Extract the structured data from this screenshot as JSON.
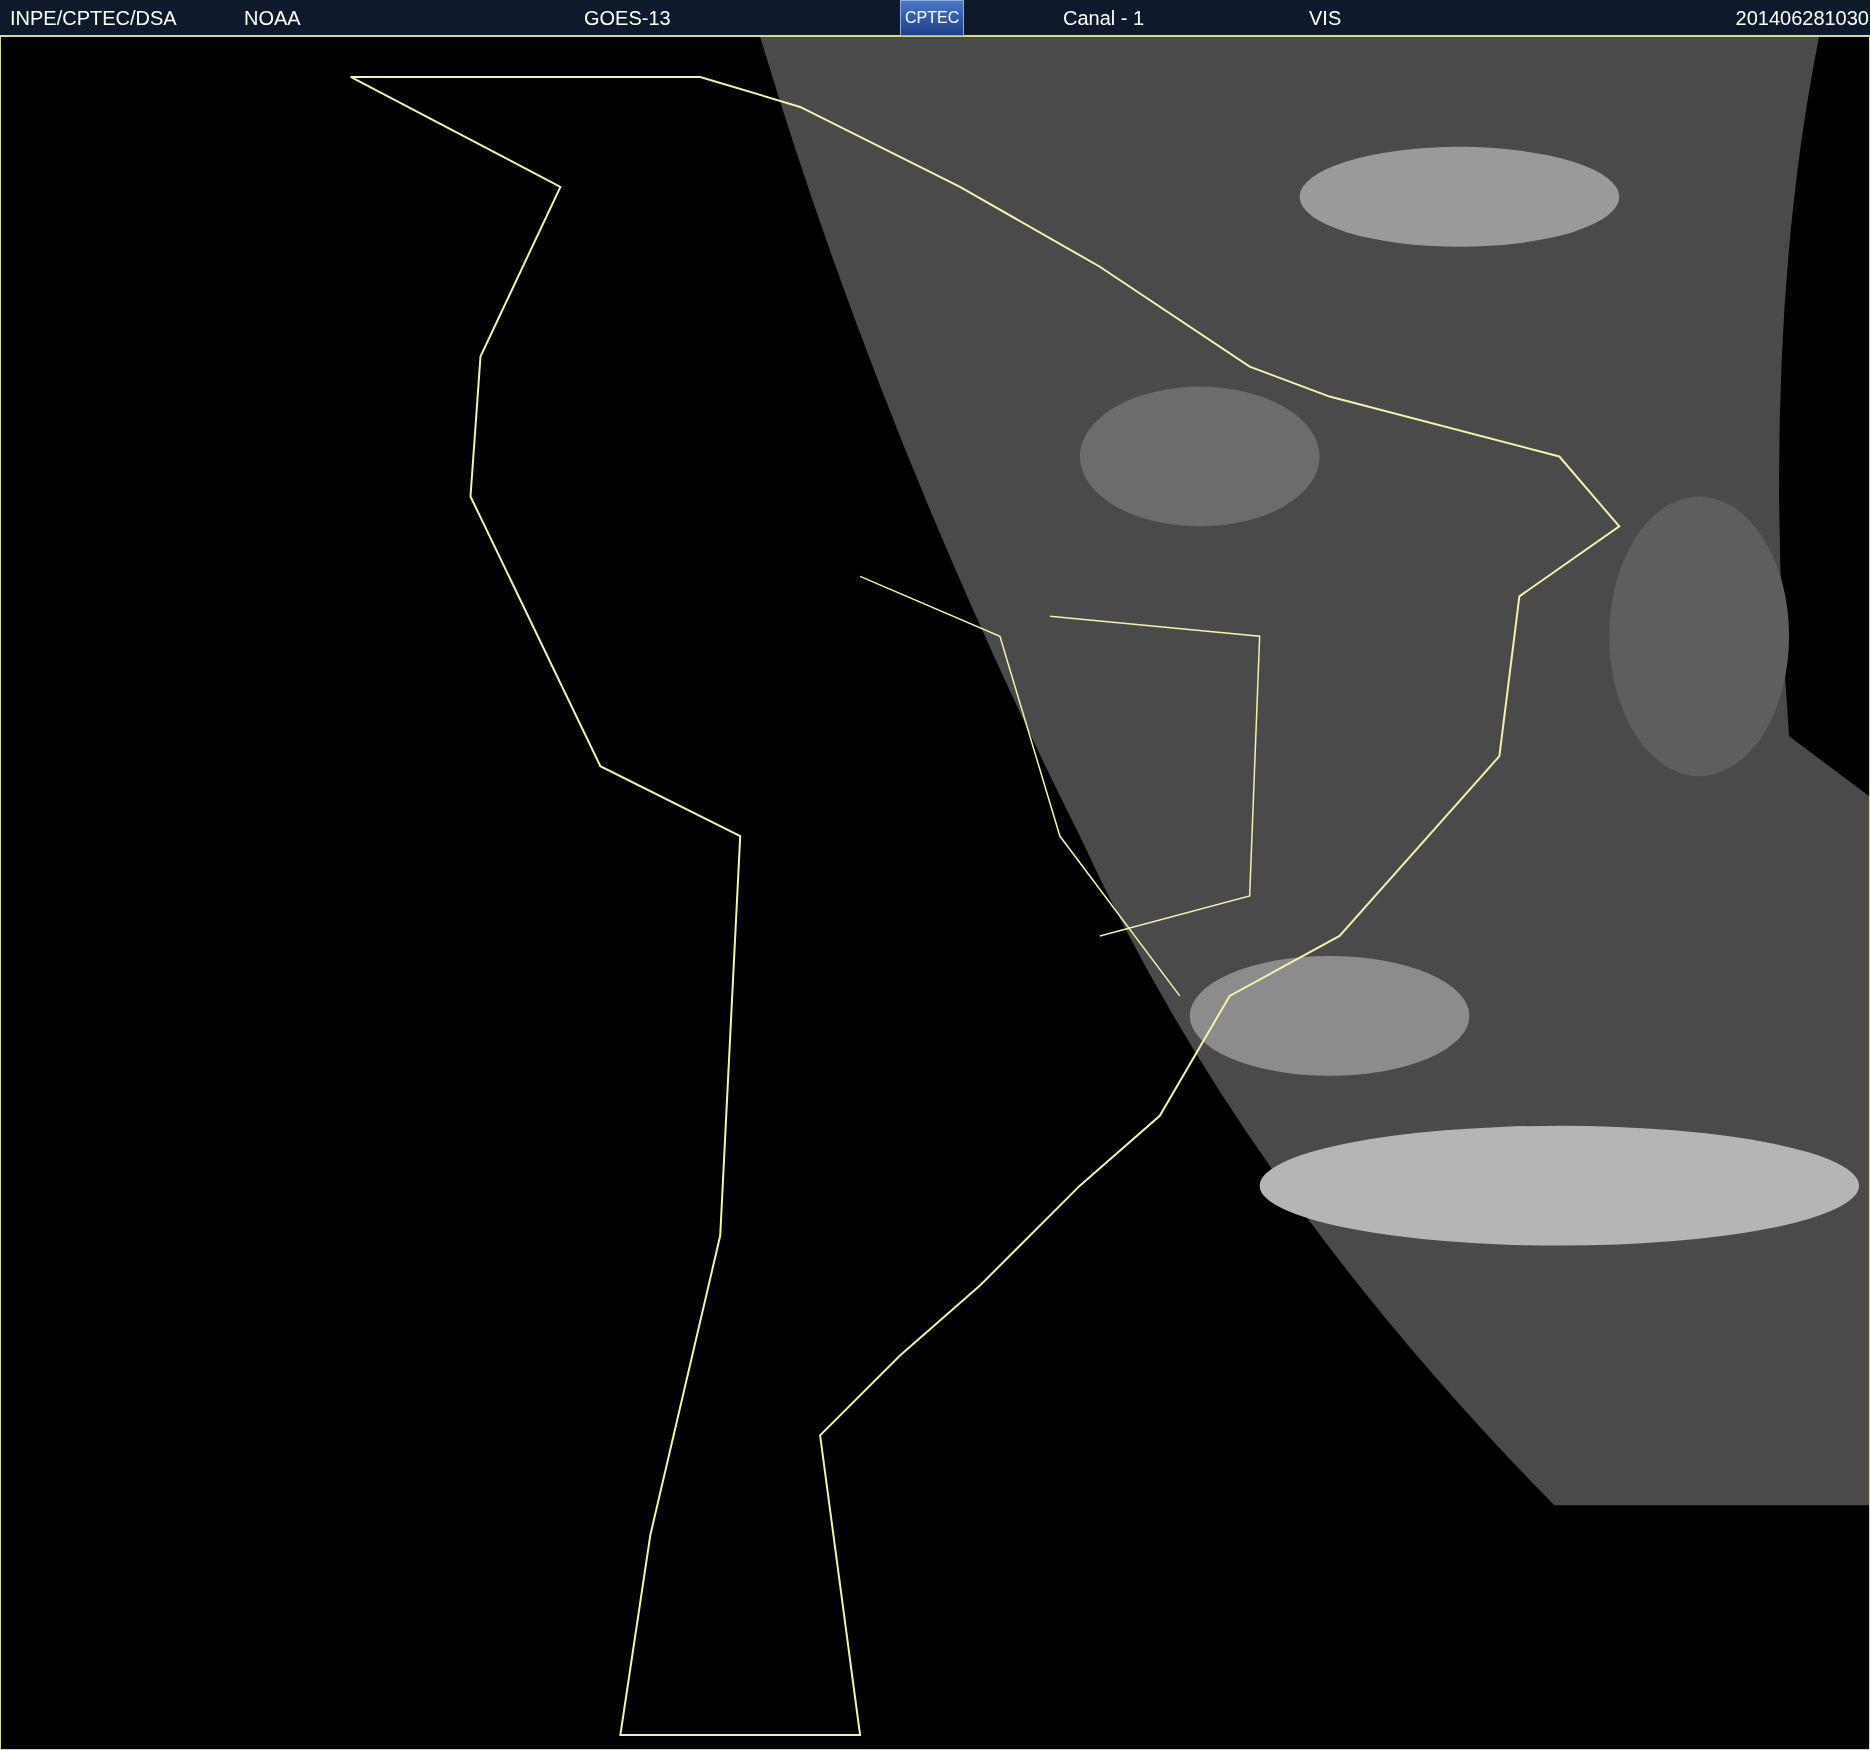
{
  "header": {
    "items": [
      {
        "kind": "text",
        "text": "INPE/CPTEC/DSA"
      },
      {
        "kind": "text",
        "text": "NOAA"
      },
      {
        "kind": "text",
        "text": "GOES-13"
      },
      {
        "kind": "logo",
        "text": "CPTEC"
      },
      {
        "kind": "text",
        "text": "Canal - 1"
      },
      {
        "kind": "text",
        "text": "VIS"
      },
      {
        "kind": "text",
        "text": "201406281030"
      }
    ]
  }
}
